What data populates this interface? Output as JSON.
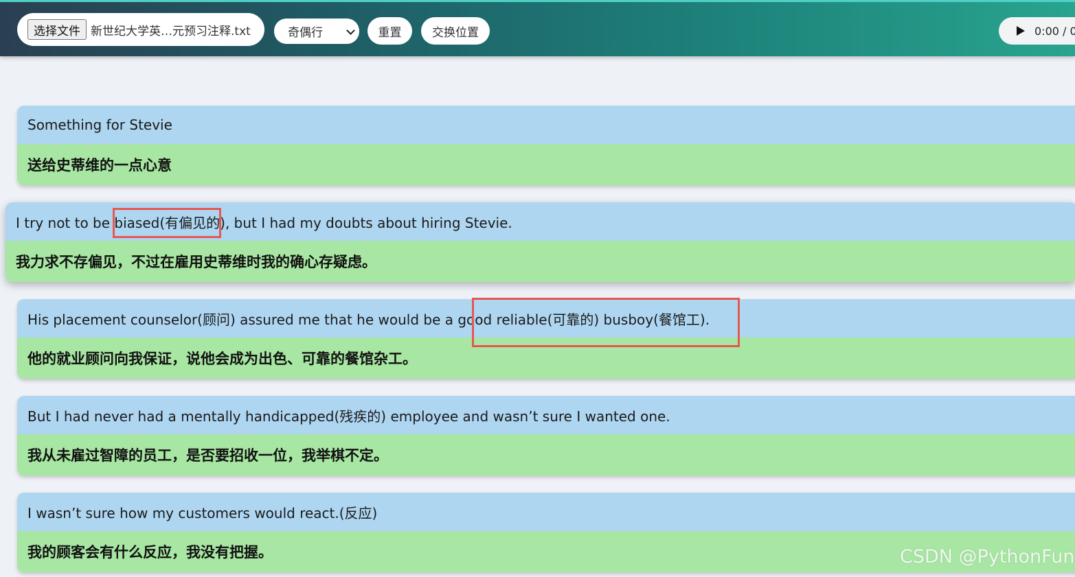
{
  "toolbar": {
    "file_button_label": "选择文件",
    "file_name": "新世纪大学英…元预习注释.txt",
    "line_mode_select": "奇偶行",
    "reset_label": "重置",
    "swap_label": "交换位置",
    "audio_time": "0:00 / 0",
    "play_icon": "play-icon"
  },
  "sentences": [
    {
      "en": "Something for Stevie",
      "zh": "送给史蒂维的一点心意"
    },
    {
      "en": "I try not to be biased(有偏见的), but I had my doubts about hiring Stevie.",
      "zh": "我力求不存偏见，不过在雇用史蒂维时我的确心存疑虑。"
    },
    {
      "en": "His placement counselor(顾问) assured me that he would be a good  reliable(可靠的) busboy(餐馆工).",
      "zh": "他的就业顾问向我保证，说他会成为出色、可靠的餐馆杂工。"
    },
    {
      "en": "But I had never had a mentally handicapped(残疾的) employee and wasn’t sure I wanted one.",
      "zh": "我从未雇过智障的员工，是否要招收一位，我举棋不定。"
    },
    {
      "en": "I wasn’t sure how my customers would react.(反应)",
      "zh": "我的顾客会有什么反应，我没有把握。"
    }
  ],
  "watermark": "CSDN @PythonFun",
  "colors": {
    "english_row": "#aed6f1",
    "chinese_row": "#a8e6a3",
    "highlight_box": "#e8564f"
  }
}
